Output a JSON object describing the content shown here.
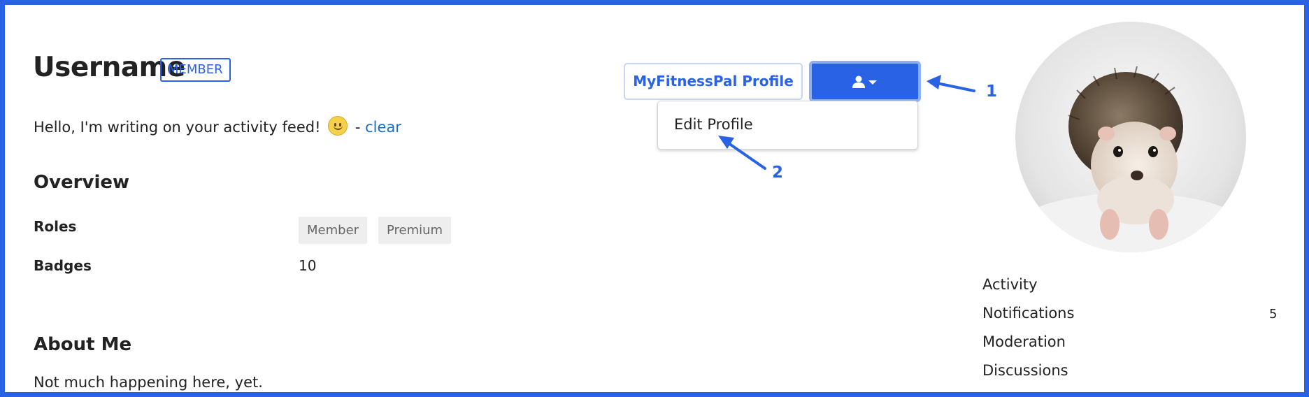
{
  "profile": {
    "username": "Username",
    "member_badge": "MEMBER",
    "status_text": "Hello, I'm writing on your activity feed!",
    "status_separator": "-",
    "clear_link": "clear"
  },
  "overview": {
    "heading": "Overview",
    "roles_label": "Roles",
    "roles": [
      "Member",
      "Premium"
    ],
    "badges_label": "Badges",
    "badges_value": "10"
  },
  "about": {
    "heading": "About Me",
    "text": "Not much happening here, yet."
  },
  "header_actions": {
    "mfp_button": "MyFitnessPal Profile",
    "user_menu_icon": "user-icon",
    "dropdown_items": [
      "Edit Profile"
    ]
  },
  "annotations": {
    "marker_1": "1",
    "marker_2": "2"
  },
  "sidebar": {
    "items": [
      {
        "label": "Activity",
        "count": ""
      },
      {
        "label": "Notifications",
        "count": "5"
      },
      {
        "label": "Moderation",
        "count": ""
      },
      {
        "label": "Discussions",
        "count": ""
      }
    ]
  },
  "colors": {
    "accent": "#2a62e6",
    "link": "#1f6dc2",
    "tag_bg": "#eeeeee"
  }
}
